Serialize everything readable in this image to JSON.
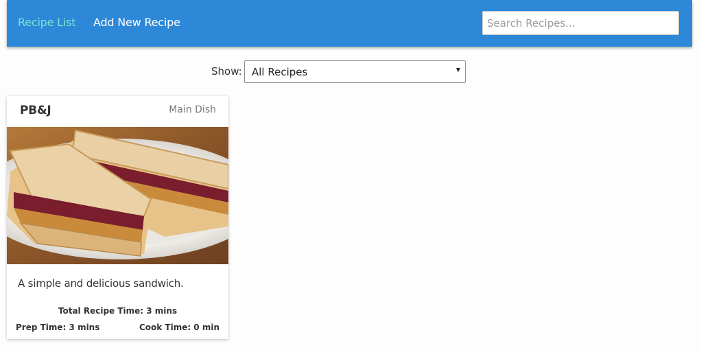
{
  "nav": {
    "recipe_list": "Recipe List",
    "add_new_recipe": "Add New Recipe",
    "search_placeholder": "Search Recipes..."
  },
  "filter": {
    "label": "Show:",
    "selected": "All Recipes"
  },
  "recipes": [
    {
      "title": "PB&J",
      "category": "Main Dish",
      "description": "A simple and delicious sandwich.",
      "total_time": "Total Recipe Time: 3 mins",
      "prep_time": "Prep Time: 3 mins",
      "cook_time": "Cook Time: 0 min"
    }
  ],
  "colors": {
    "navbar": "#2d89d8",
    "active_link": "#7fe3d2",
    "link": "#ffffff",
    "background": "#fdfdfd"
  }
}
